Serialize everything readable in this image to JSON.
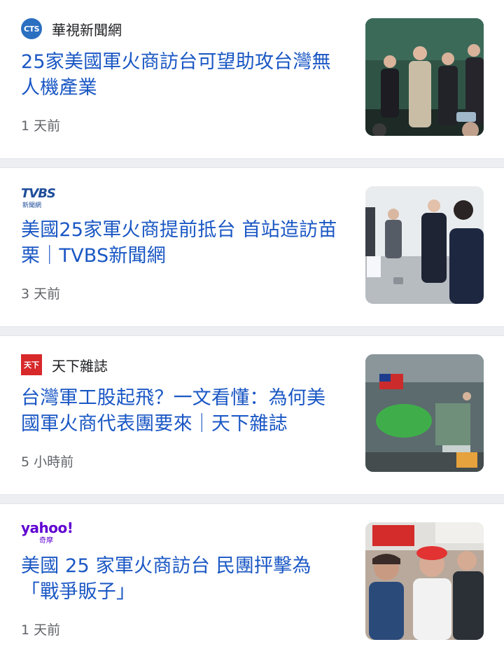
{
  "articles": [
    {
      "source": "華視新聞網",
      "logo_text": "CTS",
      "logo_icon": "cts-logo-icon",
      "headline": "25家美國軍火商訪台可望助攻台灣無人機產業",
      "time": "1 天前",
      "thumbnail": "men-in-suits-thumbs-up-photo"
    },
    {
      "source": "",
      "logo_text": "TVBS",
      "logo_subtext": "新聞網",
      "logo_icon": "tvbs-logo-icon",
      "headline": "美國25家軍火商提前抵台 首站造訪苗栗｜TVBS新聞網",
      "time": "3 天前",
      "thumbnail": "officials-meeting-photo"
    },
    {
      "source": "天下雜誌",
      "logo_text": "天下",
      "logo_icon": "commonwealth-logo-icon",
      "headline": "台灣軍工股起飛？一文看懂：為何美國軍火商代表團要來｜天下雜誌",
      "time": "5 小時前",
      "thumbnail": "factory-floor-photo"
    },
    {
      "source": "",
      "logo_text": "yahoo!",
      "logo_subtext": "奇摩",
      "logo_icon": "yahoo-logo-icon",
      "headline": "美國 25 家軍火商訪台 民團抨擊為「戰爭販子」",
      "time": "1 天前",
      "thumbnail": "protest-crowd-photo"
    }
  ],
  "colors": {
    "headline": "#1a57c4",
    "source": "#202124",
    "time": "#5f6368",
    "separator": "#eceef1"
  }
}
